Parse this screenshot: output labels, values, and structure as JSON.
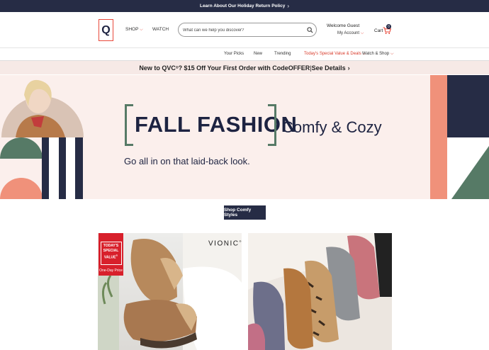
{
  "topbar": {
    "text": "Learn About Our Holiday Return Policy",
    "chevron": "›"
  },
  "header": {
    "logo": "Q",
    "shop": "SHOP",
    "watch": "WATCH",
    "search_placeholder": "What can we help you discover?",
    "welcome": "Welcome Guest",
    "my_account": "My Account",
    "cart": "Cart",
    "cart_count": "0"
  },
  "subnav": {
    "items": [
      "Your Picks",
      "New",
      "Trending",
      "Today's Special Value & Deals",
      "Watch & Shop"
    ]
  },
  "promo": {
    "bold": "New to QVC",
    "reg": "®",
    "rest_bold": "? $15 Off Your First Order with Code ",
    "code": "OFFER",
    "sep": " | ",
    "link": "See Details",
    "chevron": "›"
  },
  "hero": {
    "title": "FALL FASHION",
    "subtitle": "Comfy & Cozy",
    "copy": "Go all in on that laid-back look."
  },
  "cta": {
    "label": "Shop Comfy Styles"
  },
  "tiles": {
    "left": {
      "badge_line1": "TODAY'S SPECIAL VALUE",
      "badge_mark": "®",
      "badge_line2": "One-Day Price",
      "brand": "VIONIC",
      "brand_mark": "®"
    }
  },
  "colors": {
    "navy": "#262c45",
    "accent_red": "#e8483a",
    "green": "#567a66",
    "salmon": "#f0917a",
    "hero_bg": "#fbefec"
  }
}
